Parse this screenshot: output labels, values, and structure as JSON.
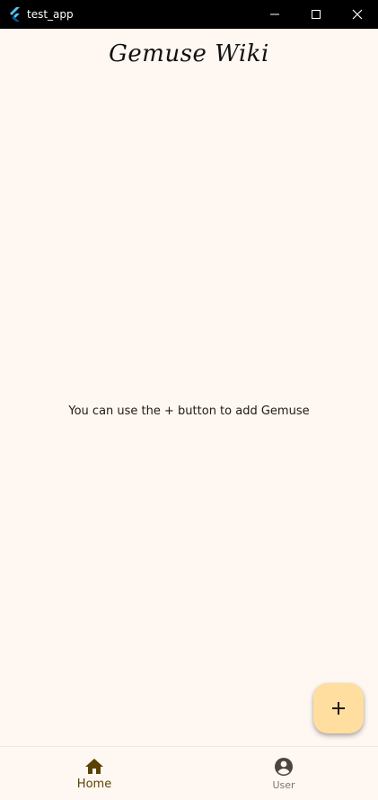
{
  "window": {
    "title": "test_app",
    "app_icon": "flutter-icon",
    "controls": [
      "minimize-icon",
      "maximize-icon",
      "close-icon"
    ]
  },
  "appbar": {
    "title": "Gemuse Wiki"
  },
  "main": {
    "empty_message": "You can use the + button to add Gemuse"
  },
  "fab": {
    "icon": "plus-icon"
  },
  "bottom_nav": {
    "items": [
      {
        "label": "Home",
        "icon": "home-icon",
        "selected": true
      },
      {
        "label": "User",
        "icon": "account-circle-icon",
        "selected": false
      }
    ]
  },
  "colors": {
    "background": "#fff7f2",
    "titlebar": "#000000",
    "fab": "#ffdea0",
    "nav_selected": "#5a4300",
    "nav_unselected": "#7a7571"
  }
}
